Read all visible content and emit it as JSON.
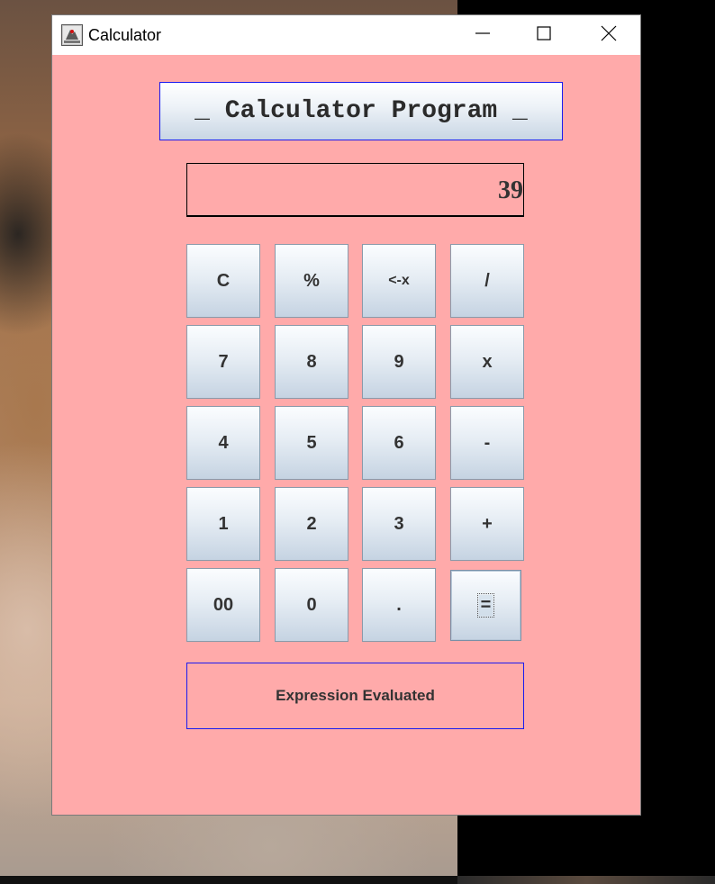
{
  "window": {
    "title": "Calculator",
    "controls": [
      "minimize-icon",
      "maximize-icon",
      "close-icon"
    ]
  },
  "heading": "_ Calculator Program _",
  "display": {
    "value": "39"
  },
  "keypad": {
    "rows": [
      [
        "C",
        "%",
        "<-x",
        "/"
      ],
      [
        "7",
        "8",
        "9",
        "x"
      ],
      [
        "4",
        "5",
        "6",
        "-"
      ],
      [
        "1",
        "2",
        "3",
        "+"
      ],
      [
        "00",
        "0",
        ".",
        "="
      ]
    ],
    "focused_key": "="
  },
  "status": "Expression Evaluated",
  "colors": {
    "background": "#ffaaaa",
    "border_accent": "#1a1af0",
    "button_top": "#fbfdff",
    "button_bottom": "#c5d3e2"
  }
}
